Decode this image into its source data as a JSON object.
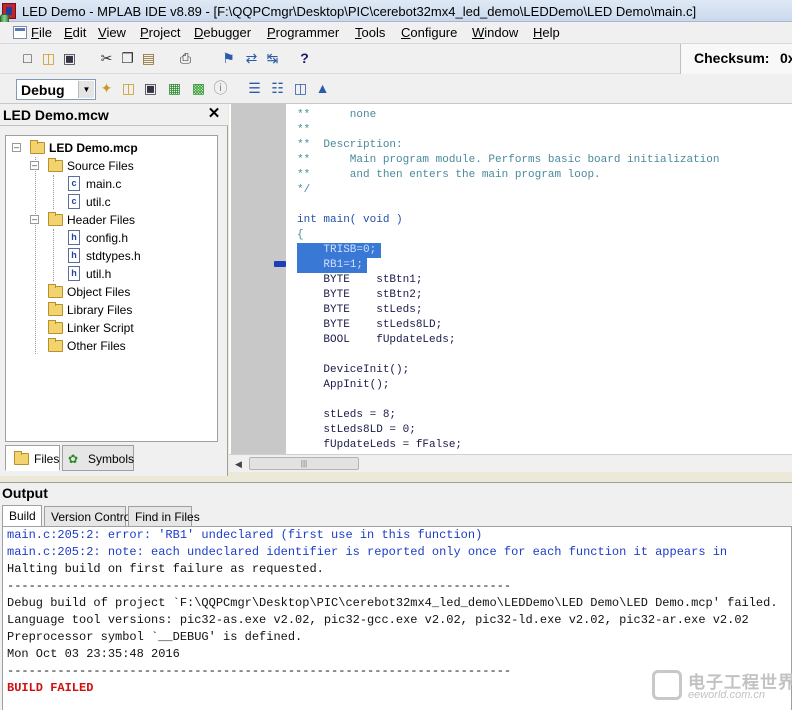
{
  "window": {
    "title": "LED Demo - MPLAB IDE v8.89 - [F:\\QQPCmgr\\Desktop\\PIC\\cerebot32mx4_led_demo\\LEDDemo\\LED Demo\\main.c]"
  },
  "menu": [
    "File",
    "Edit",
    "View",
    "Project",
    "Debugger",
    "Programmer",
    "Tools",
    "Configure",
    "Window",
    "Help"
  ],
  "toolbar": {
    "checksum_label": "Checksum:",
    "checksum_value": "0x",
    "build_config": "Debug",
    "icons_row1": [
      "new-file-icon",
      "open-folder-icon",
      "save-icon",
      "cut-icon",
      "copy-icon",
      "paste-icon",
      "print-icon",
      "bookmark-icon",
      "help-icon"
    ],
    "icons_row2": [
      "new-project-icon",
      "open-project-icon",
      "save-project-icon",
      "project-wizard-icon",
      "build-icon",
      "info-icon",
      "make-icon",
      "build-all-icon",
      "find-icon",
      "compile-icon"
    ]
  },
  "project": {
    "pane_title": "LED Demo.mcw",
    "root": "LED Demo.mcp",
    "folders": [
      {
        "name": "Source Files",
        "files": [
          "main.c",
          "util.c"
        ]
      },
      {
        "name": "Header Files",
        "files": [
          "config.h",
          "stdtypes.h",
          "util.h"
        ]
      },
      {
        "name": "Object Files",
        "files": []
      },
      {
        "name": "Library Files",
        "files": []
      },
      {
        "name": "Linker Script",
        "files": []
      },
      {
        "name": "Other Files",
        "files": []
      }
    ],
    "tabs": [
      "Files",
      "Symbols"
    ]
  },
  "editor": {
    "lines": [
      "**      none",
      "**",
      "**  Description:",
      "**      Main program module. Performs basic board initialization",
      "**      and then enters the main program loop.",
      "*/",
      "",
      "int main( void )",
      "{",
      "    TRISB=0;",
      "    RB1=1;",
      "    BYTE    stBtn1;",
      "    BYTE    stBtn2;",
      "    BYTE    stLeds;",
      "    BYTE    stLeds8LD;",
      "    BOOL    fUpdateLeds;",
      "",
      "    DeviceInit();",
      "    AppInit();",
      "",
      "    stLeds = 8;",
      "    stLeds8LD = 0;",
      "    fUpdateLeds = fFalse;"
    ]
  },
  "output": {
    "title": "Output",
    "tabs": [
      "Build",
      "Version Control",
      "Find in Files"
    ],
    "lines": [
      {
        "text": "main.c:205:2: error: 'RB1' undeclared (first use in this function)",
        "style": "blue"
      },
      {
        "text": "main.c:205:2: note: each undeclared identifier is reported only once for each function it appears in",
        "style": "blue"
      },
      {
        "text": "Halting build on first failure as requested.",
        "style": "black"
      },
      {
        "text": "----------------------------------------------------------------------",
        "style": "black"
      },
      {
        "text": "Debug build of project `F:\\QQPCmgr\\Desktop\\PIC\\cerebot32mx4_led_demo\\LEDDemo\\LED Demo\\LED Demo.mcp' failed.",
        "style": "black"
      },
      {
        "text": "Language tool versions: pic32-as.exe v2.02, pic32-gcc.exe v2.02, pic32-ld.exe v2.02, pic32-ar.exe v2.02",
        "style": "black"
      },
      {
        "text": "Preprocessor symbol `__DEBUG' is defined.",
        "style": "black"
      },
      {
        "text": "Mon Oct 03 23:35:48 2016",
        "style": "black"
      },
      {
        "text": "----------------------------------------------------------------------",
        "style": "black"
      },
      {
        "text": "BUILD FAILED",
        "style": "red"
      }
    ]
  },
  "watermark": {
    "text": "电子工程世界",
    "url": "eeworld.com.cn"
  },
  "colors": {
    "selection": "#3a78d6",
    "error_text": "#1c3dc8",
    "failed_text": "#d01010",
    "comment": "#4a8a9c"
  }
}
